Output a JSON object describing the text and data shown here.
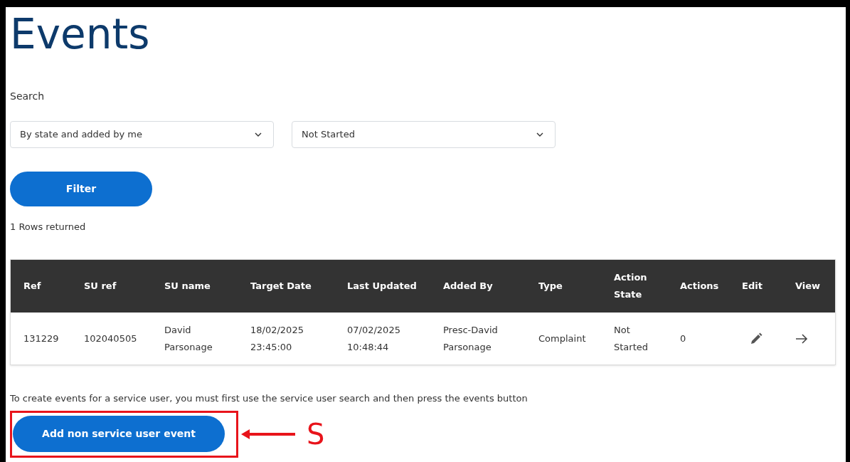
{
  "page": {
    "title": "Events"
  },
  "search": {
    "label": "Search",
    "selects": [
      {
        "value": "By state and added by me"
      },
      {
        "value": "Not Started"
      }
    ],
    "button": "Filter"
  },
  "result_count": "1 Rows returned",
  "table": {
    "columns": [
      "Ref",
      "SU ref",
      "SU name",
      "Target Date",
      "Last Updated",
      "Added By",
      "Type",
      "Action State",
      "Actions",
      "Edit",
      "View"
    ],
    "rows": [
      {
        "cells": [
          "131229",
          "102040505",
          "David Parsonage",
          "18/02/2025 23:45:00",
          "07/02/2025 10:48:44",
          "Presc-David Parsonage",
          "Complaint",
          "Not Started",
          "0"
        ]
      }
    ]
  },
  "note": "To create events for a service user, you must first use the service user search and then press the events button",
  "add_button": "Add non service user event",
  "annotation": {
    "label": "S"
  }
}
